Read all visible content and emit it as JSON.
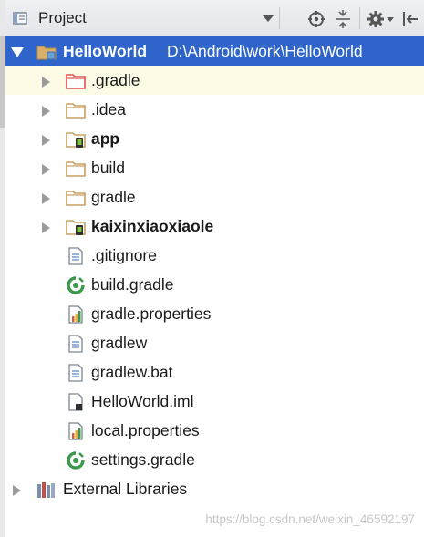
{
  "toolbar": {
    "title": "Project"
  },
  "root": {
    "name": "HelloWorld",
    "path": "D:\\Android\\work\\HelloWorld"
  },
  "items": [
    {
      "label": ".gradle"
    },
    {
      "label": ".idea"
    },
    {
      "label": "app"
    },
    {
      "label": "build"
    },
    {
      "label": "gradle"
    },
    {
      "label": "kaixinxiaoxiaole"
    },
    {
      "label": ".gitignore"
    },
    {
      "label": "build.gradle"
    },
    {
      "label": "gradle.properties"
    },
    {
      "label": "gradlew"
    },
    {
      "label": "gradlew.bat"
    },
    {
      "label": "HelloWorld.iml"
    },
    {
      "label": "local.properties"
    },
    {
      "label": "settings.gradle"
    }
  ],
  "external_libraries": "External Libraries",
  "watermark": "https://blog.csdn.net/weixin_46592197",
  "colors": {
    "selection": "#2f65ca",
    "folder": "#c8a063",
    "excluded_folder": "#d9534f",
    "gradle_green": "#3a9a4a"
  }
}
